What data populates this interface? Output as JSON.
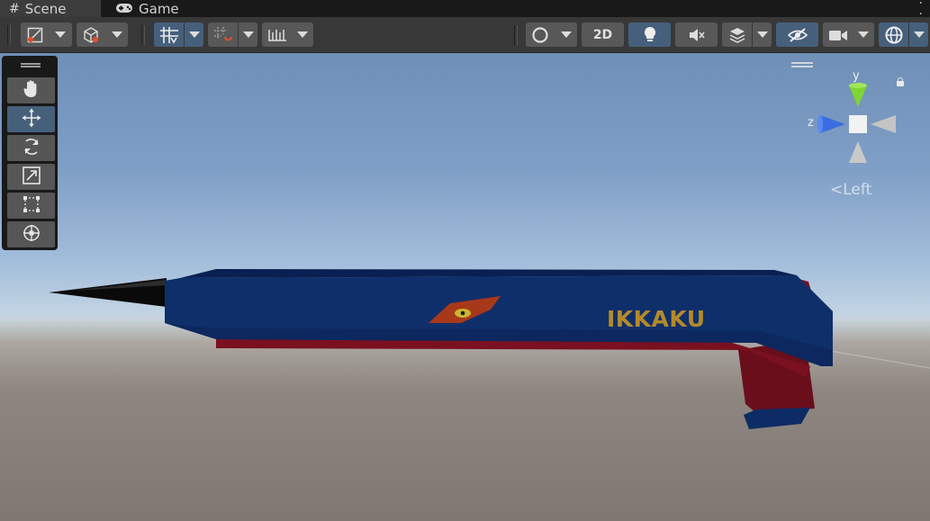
{
  "tabs": [
    {
      "label": "Scene",
      "icon": "hash-icon",
      "active": true
    },
    {
      "label": "Game",
      "icon": "gamepad-icon",
      "active": false
    }
  ],
  "toolbar": {
    "twoD_label": "2D",
    "buttons": [
      "draw-mode-icon",
      "shading-cube-icon",
      "grid-snap-icon",
      "snap-increment-icon",
      "ruler-icon",
      "render-mode-icon",
      "lighting-bulb-icon",
      "audio-mute-icon",
      "effects-layers-icon",
      "visibility-eye-icon",
      "camera-icon",
      "gizmo-globe-icon"
    ]
  },
  "tools": [
    "hand-tool-icon",
    "move-tool-icon",
    "rotate-tool-icon",
    "scale-tool-icon",
    "rect-tool-icon",
    "transform-tool-icon"
  ],
  "active_tool": "move-tool-icon",
  "orientation_gizmo": {
    "y_label": "y",
    "z_label": "z",
    "view_label": "Left"
  },
  "model": {
    "logo_text": "IKKAKU",
    "colors": {
      "body": "#0f2f6b",
      "trim": "#7a1020",
      "logo": "#b48a2a",
      "spike": "#0a0a0a"
    }
  }
}
